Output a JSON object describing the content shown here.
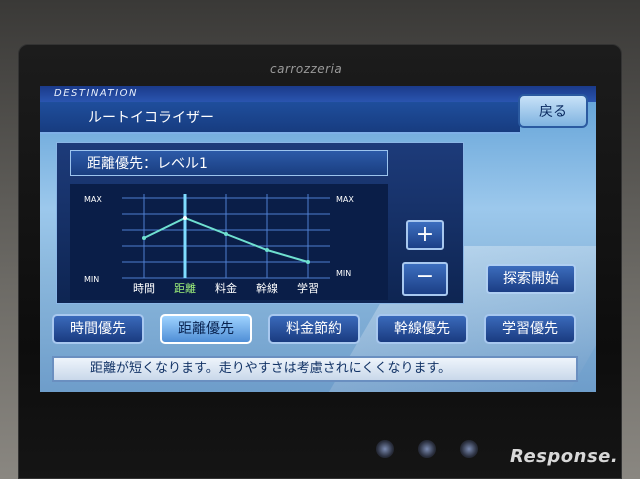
{
  "device": {
    "brand": "carrozzeria"
  },
  "header": {
    "destination_label": "DESTINATION",
    "title": "ルートイコライザー",
    "back_label": "戻る"
  },
  "level_display": {
    "text": "距離優先：レベル1"
  },
  "graph": {
    "max_label": "MAX",
    "min_label": "MIN",
    "categories": [
      "時間",
      "距離",
      "料金",
      "幹線",
      "学習"
    ],
    "values": [
      0.5,
      0.75,
      0.55,
      0.35,
      0.2
    ],
    "highlighted_index": 1
  },
  "controls": {
    "plus_label": "+",
    "minus_label": "−",
    "search_label": "探索開始"
  },
  "priorities": [
    {
      "label": "時間優先",
      "selected": false
    },
    {
      "label": "距離優先",
      "selected": true
    },
    {
      "label": "料金節約",
      "selected": false
    },
    {
      "label": "幹線優先",
      "selected": false
    },
    {
      "label": "学習優先",
      "selected": false
    }
  ],
  "message": "距離が短くなります。走りやすさは考慮されにくくなります。",
  "watermark": "Response."
}
